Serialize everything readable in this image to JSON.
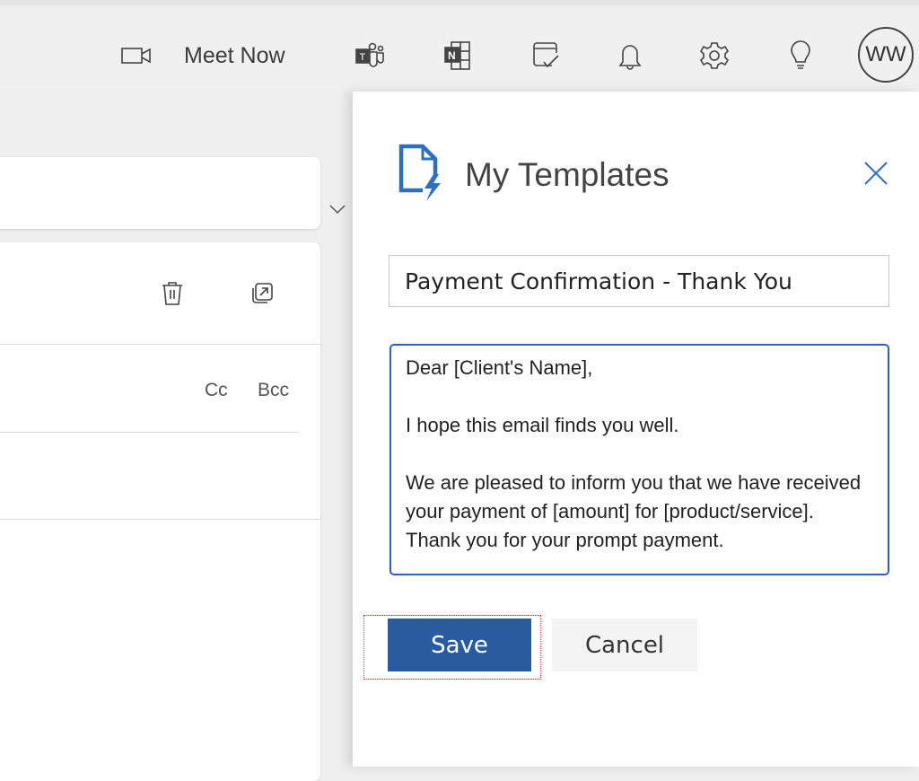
{
  "topbar": {
    "meet_now_label": "Meet Now",
    "icons": [
      "video-camera-icon",
      "teams-icon",
      "onenote-icon",
      "todo-icon",
      "bell-icon",
      "gear-icon",
      "lightbulb-icon"
    ],
    "avatar_initials": "WW"
  },
  "compose": {
    "cc_label": "Cc",
    "bcc_label": "Bcc"
  },
  "panel": {
    "title": "My Templates",
    "template_name": "Payment Confirmation - Thank You",
    "template_body": "Dear [Client's Name],\n\nI hope this email finds you well.\n\nWe are pleased to inform you that we have received your payment of [amount] for [product/service]. Thank you for your prompt payment.",
    "save_label": "Save",
    "cancel_label": "Cancel",
    "accent_color": "#2a5b9f"
  }
}
